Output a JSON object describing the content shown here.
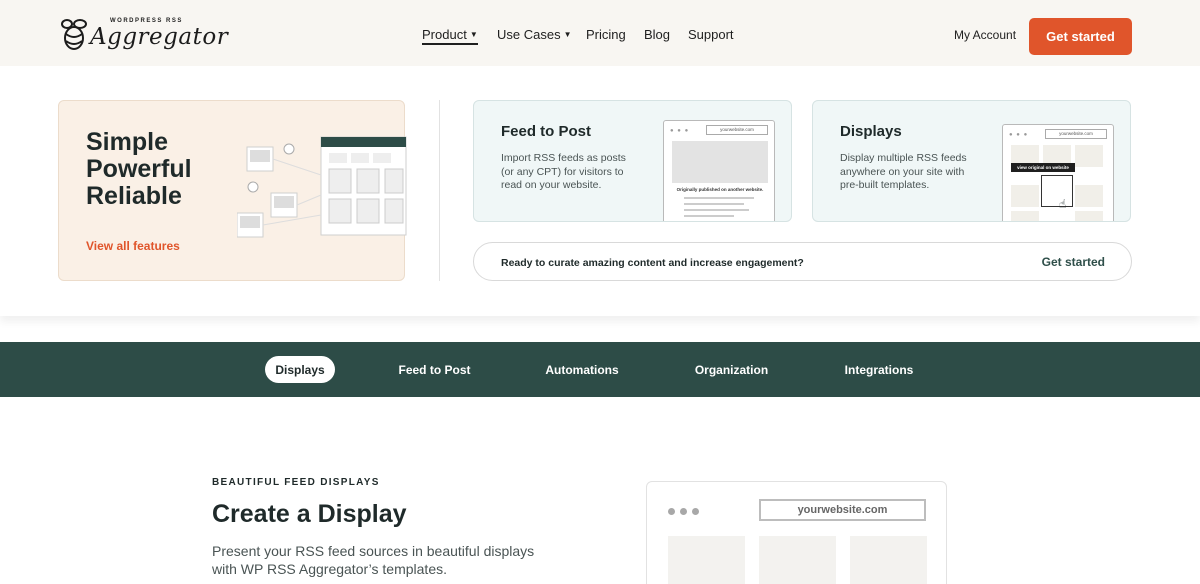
{
  "header": {
    "logo_small": "WORDPRESS RSS",
    "logo_main": "Aggregator",
    "nav": [
      {
        "label": "Product"
      },
      {
        "label": "Use Cases"
      },
      {
        "label": "Pricing"
      },
      {
        "label": "Blog"
      },
      {
        "label": "Support"
      }
    ],
    "my_account": "My Account",
    "cta": "Get started"
  },
  "panel": {
    "feature": {
      "title_lines": [
        "Simple",
        "Powerful",
        "Reliable"
      ],
      "link": "View all features"
    },
    "cards": [
      {
        "title": "Feed to Post",
        "desc": "Import RSS feeds as posts (or any CPT) for visitors to read on your website.",
        "mock_url": "yourwebsite.com",
        "mock_caption": "Originally published on another website."
      },
      {
        "title": "Displays",
        "desc": "Display multiple RSS feeds anywhere on your site with pre-built templates.",
        "mock_url": "yourwebsite.com",
        "mock_caption": "view original on website"
      }
    ],
    "cta_bar": {
      "text": "Ready to curate amazing content and increase engagement?",
      "link": "Get started"
    }
  },
  "tabs": [
    "Displays",
    "Feed to Post",
    "Automations",
    "Organization",
    "Integrations"
  ],
  "section": {
    "eyebrow": "BEAUTIFUL FEED DISPLAYS",
    "title": "Create a Display",
    "desc": "Present your RSS feed sources in beautiful displays with WP RSS Aggregator’s templates.",
    "preview_url": "yourwebsite.com"
  },
  "colors": {
    "accent": "#e0552b",
    "dark_green": "#2d4c47",
    "header_bg": "#f8f6f2",
    "feature_bg": "#faf0e6",
    "card_bg": "#f0f7f7"
  }
}
